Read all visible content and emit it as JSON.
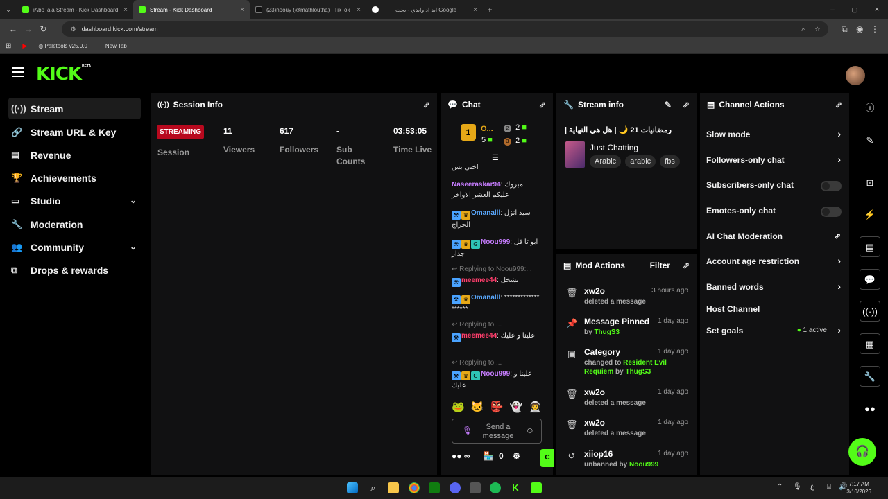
{
  "browser": {
    "tabs": [
      {
        "label": "iAboTala Stream - Kick Dashboard",
        "icon": "kick-icon",
        "color": "#53fc18"
      },
      {
        "label": "Stream - Kick Dashboard",
        "icon": "kick-icon",
        "color": "#53fc18"
      },
      {
        "label": "(23)noouy (@mathloutha) | TikTok",
        "icon": "tiktok-icon",
        "color": "#ffffff"
      },
      {
        "label": "ايد اد وايدي - بحث Google",
        "icon": "google-icon",
        "color": "#ffffff"
      }
    ],
    "url": "dashboard.kick.com/stream",
    "bookmarks": [
      "Paletools v25.0.0",
      "New Tab"
    ]
  },
  "header": {
    "logo": "KICK",
    "beta": "BETA"
  },
  "sidebar": {
    "items": [
      {
        "label": "Stream",
        "icon": "stream-icon"
      },
      {
        "label": "Stream URL & Key",
        "icon": "link-icon"
      },
      {
        "label": "Revenue",
        "icon": "revenue-icon"
      },
      {
        "label": "Achievements",
        "icon": "trophy-icon"
      },
      {
        "label": "Studio",
        "icon": "studio-icon"
      },
      {
        "label": "Moderation",
        "icon": "wrench-icon"
      },
      {
        "label": "Community",
        "icon": "community-icon"
      },
      {
        "label": "Drops & rewards",
        "icon": "drops-icon"
      }
    ]
  },
  "session": {
    "title": "Session Info",
    "status": "STREAMING",
    "status_label": "Session",
    "viewers": "11",
    "viewers_label": "Viewers",
    "followers": "617",
    "followers_label": "Followers",
    "subs": "-",
    "subs_label": "Sub Counts",
    "time": "03:53:05",
    "time_label": "Time Live"
  },
  "chat": {
    "title": "Chat",
    "leader_name": "O...",
    "leader_count": "5",
    "rank2": "2",
    "rank3": "2",
    "messages": [
      {
        "user": "",
        "text": "اختي بس"
      },
      {
        "user": "Naseeraskar94",
        "text": "مبروك عليكم العشر الاواخر"
      },
      {
        "user": "Omanalll",
        "text": "سيد انزل الحراج"
      },
      {
        "user": "Noou999",
        "text": "ابو تا قل جدار"
      },
      {
        "user": "meemee44",
        "text": "تشخل",
        "reply": "Replying to Noou999:..."
      },
      {
        "user": "Omanalll",
        "text": "*******************"
      },
      {
        "user": "meemee44",
        "text": "علينا و عليك",
        "reply": "Replying to ..."
      },
      {
        "user": "Noou999",
        "text": "علينا و عليك",
        "reply": "Replying to ..."
      }
    ],
    "input_placeholder": "Send a message",
    "points": "0",
    "send": "C"
  },
  "stream_info": {
    "title": "Stream info",
    "stream_title": "رمضانيات 21 🌙 | هل هي النهاية |",
    "category": "Just Chatting",
    "tags": [
      "Arabic",
      "arabic",
      "fbs"
    ]
  },
  "mod_actions": {
    "title": "Mod Actions",
    "filter": "Filter",
    "items": [
      {
        "icon": "trash-icon",
        "title": "xw2o",
        "time": "3 hours ago",
        "desc": "deleted a message",
        "extra": ""
      },
      {
        "icon": "pin-icon",
        "title": "Message Pinned",
        "time": "1 day ago",
        "desc": "by",
        "extra": "ThugS3"
      },
      {
        "icon": "category-icon",
        "title": "Category",
        "time": "1 day ago",
        "desc": "changed to",
        "extra": "Resident Evil Requiem",
        "by": "by",
        "by_user": "ThugS3"
      },
      {
        "icon": "trash-icon",
        "title": "xw2o",
        "time": "1 day ago",
        "desc": "deleted a message",
        "extra": ""
      },
      {
        "icon": "trash-icon",
        "title": "xw2o",
        "time": "1 day ago",
        "desc": "deleted a message",
        "extra": ""
      },
      {
        "icon": "unban-icon",
        "title": "xiiop16",
        "time": "1 day ago",
        "desc": "unbanned by",
        "extra": "Noou999"
      }
    ]
  },
  "channel_actions": {
    "title": "Channel Actions",
    "items": [
      {
        "label": "Slow mode",
        "control": "arrow"
      },
      {
        "label": "Followers-only chat",
        "control": "arrow"
      },
      {
        "label": "Subscribers-only chat",
        "control": "toggle"
      },
      {
        "label": "Emotes-only chat",
        "control": "toggle"
      },
      {
        "label": "AI Chat Moderation",
        "control": "external"
      },
      {
        "label": "Account age restriction",
        "control": "arrow"
      },
      {
        "label": "Banned words",
        "control": "arrow"
      },
      {
        "label": "Host Channel",
        "control": "none"
      },
      {
        "label": "Set goals",
        "control": "arrow",
        "status": "1 active"
      }
    ]
  },
  "taskbar": {
    "time": "7:17 AM",
    "date": "3/10/2026",
    "lang": "ع"
  }
}
